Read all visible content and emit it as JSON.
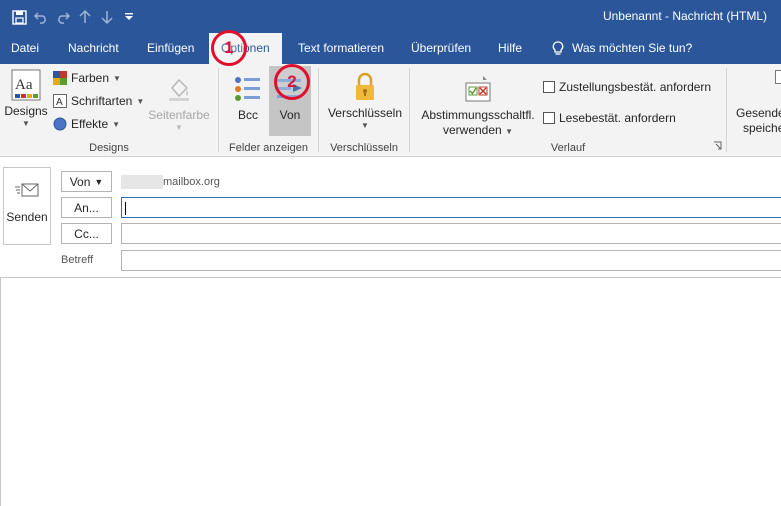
{
  "window": {
    "title": "Unbenannt  -  Nachricht (HTML)"
  },
  "qat": {
    "icons": [
      "save-icon",
      "undo-icon",
      "redo-icon",
      "up-icon",
      "down-icon",
      "customize-icon"
    ]
  },
  "tabs": [
    {
      "label": "Datei"
    },
    {
      "label": "Nachricht"
    },
    {
      "label": "Einfügen"
    },
    {
      "label": "Optionen",
      "active": true
    },
    {
      "label": "Text formatieren"
    },
    {
      "label": "Überprüfen"
    },
    {
      "label": "Hilfe"
    }
  ],
  "tellme": {
    "label": "Was möchten Sie tun?"
  },
  "ribbon": {
    "designs": {
      "big_label": "Designs",
      "farben": "Farben",
      "schriftarten": "Schriftarten",
      "effekte": "Effekte",
      "seitenfarbe": "Seitenfarbe",
      "group_label": "Designs"
    },
    "felder": {
      "bcc": "Bcc",
      "von": "Von",
      "group_label": "Felder anzeigen"
    },
    "verschluesseln": {
      "button": "Verschlüsseln",
      "group_label": "Verschlüsseln"
    },
    "verlauf": {
      "abstimmung_line1": "Abstimmungsschaltfl.",
      "abstimmung_line2": "verwenden",
      "zustellung": "Zustellungsbestät. anfordern",
      "lese": "Lesebestät. anfordern",
      "group_label": "Verlauf"
    },
    "gesendet": {
      "line1": "Gesende",
      "line2": "speiche"
    }
  },
  "annotations": {
    "one": "1",
    "two": "2"
  },
  "compose": {
    "send": "Senden",
    "von_button": "Von",
    "from_address": "mailbox.org",
    "an_button": "An...",
    "cc_button": "Cc...",
    "betreff_label": "Betreff"
  }
}
